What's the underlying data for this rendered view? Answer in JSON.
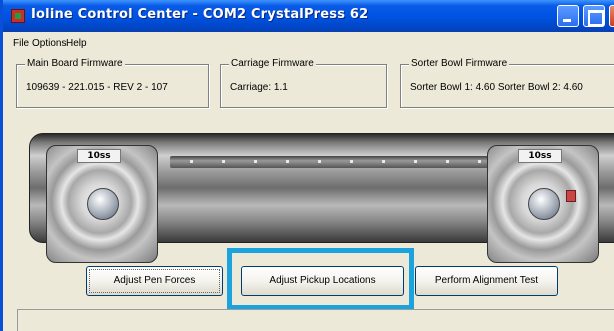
{
  "window": {
    "title": "Ioline Control Center  -  COM2  CrystalPress   62"
  },
  "menu": {
    "file": "File",
    "options": "Options",
    "help": "Help"
  },
  "firmware": {
    "main_board": {
      "legend": "Main Board Firmware",
      "value": "109639 - 221.015 - REV 2 - 107"
    },
    "carriage": {
      "legend": "Carriage Firmware",
      "value": "Carriage: 1.1"
    },
    "sorter_bowl": {
      "legend": "Sorter Bowl Firmware",
      "value": "Sorter Bowl 1: 4.60    Sorter Bowl 2: 4.60"
    }
  },
  "machine": {
    "left_bowl_label": "10ss",
    "right_bowl_label": "10ss"
  },
  "buttons": {
    "adjust_pen_forces": "Adjust Pen Forces",
    "adjust_pickup_locations": "Adjust Pickup Locations",
    "perform_alignment_test": "Perform Alignment Test"
  },
  "colors": {
    "titlebar": "#0054e3",
    "window_bg": "#ece9d8",
    "highlight": "#1aa3dc"
  },
  "status": {
    "text": ""
  }
}
